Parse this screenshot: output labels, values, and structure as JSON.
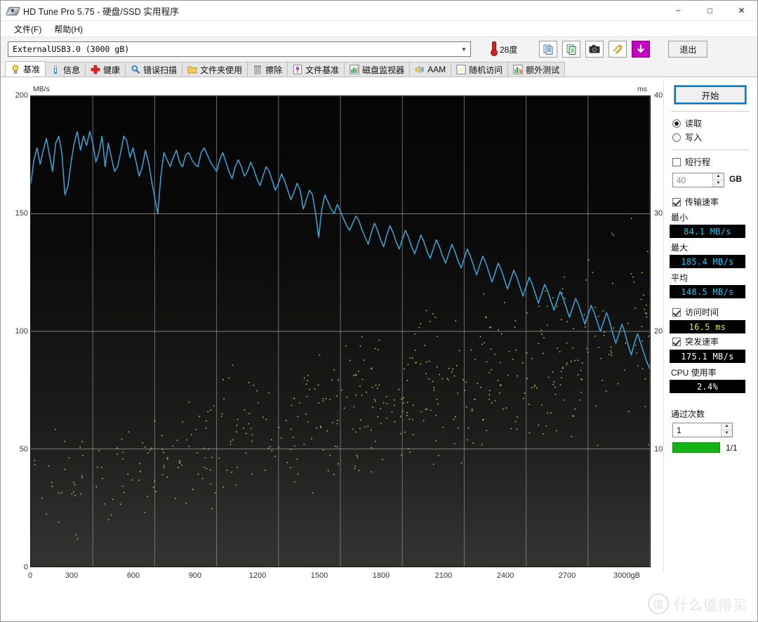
{
  "window": {
    "title": "HD Tune Pro 5.75 - 硬盘/SSD 实用程序",
    "icon": "hard-disk-icon",
    "minimize": "−",
    "maximize": "□",
    "close": "✕"
  },
  "menu": [
    {
      "label": "文件(F)"
    },
    {
      "label": "帮助(H)"
    }
  ],
  "drive": {
    "selected": "ExternalUSB3.0  (3000 gB)",
    "dropdown_arrow": "▼"
  },
  "temperature": {
    "value": "28度",
    "icon": "thermometer-icon"
  },
  "toolbar": {
    "buttons": [
      {
        "name": "copy-icon",
        "label": ""
      },
      {
        "name": "export-excel-icon",
        "label": ""
      },
      {
        "name": "screenshot-camera-icon",
        "label": ""
      },
      {
        "name": "attachment-icon",
        "label": ""
      },
      {
        "name": "download-arrow-icon",
        "label": ""
      }
    ],
    "exit_label": "退出"
  },
  "tabs": [
    {
      "label": "基准",
      "icon": "benchmark-icon",
      "active": true
    },
    {
      "label": "信息",
      "icon": "info-icon",
      "active": false
    },
    {
      "label": "健康",
      "icon": "health-cross-icon",
      "active": false
    },
    {
      "label": "错误扫描",
      "icon": "magnifier-icon",
      "active": false
    },
    {
      "label": "文件夹使用",
      "icon": "folder-icon",
      "active": false
    },
    {
      "label": "擦除",
      "icon": "trash-icon",
      "active": false
    },
    {
      "label": "文件基准",
      "icon": "file-benchmark-icon",
      "active": false
    },
    {
      "label": "磁盘监视器",
      "icon": "disk-monitor-icon",
      "active": false
    },
    {
      "label": "AAM",
      "icon": "speaker-icon",
      "active": false
    },
    {
      "label": "随机访问",
      "icon": "random-access-icon",
      "active": false
    },
    {
      "label": "额外测试",
      "icon": "extra-tests-icon",
      "active": false
    }
  ],
  "panel": {
    "start_label": "开始",
    "mode": {
      "read_label": "读取",
      "write_label": "写入",
      "selected": "读取"
    },
    "short_stroke": {
      "label": "短行程",
      "checked": false,
      "value": "40",
      "unit": "GB"
    },
    "transfer_rate": {
      "label": "传输速率",
      "checked": true
    },
    "minimum": {
      "label": "最小",
      "value": "84.1 MB/s"
    },
    "maximum": {
      "label": "最大",
      "value": "185.4 MB/s"
    },
    "average": {
      "label": "平均",
      "value": "148.5 MB/s"
    },
    "access_time": {
      "label": "访问时间",
      "checked": true,
      "value": "16.5 ms"
    },
    "burst_rate": {
      "label": "突发速率",
      "checked": true,
      "value": "175.1 MB/s"
    },
    "cpu_usage": {
      "label": "CPU 使用率",
      "value": "2.4%"
    },
    "passes": {
      "label": "通过次数",
      "value": "1",
      "progress_text": "1/1",
      "progress_percent": 100
    }
  },
  "colors": {
    "transfer_line": "#3aa6d8",
    "access_dot": "#d8d86a",
    "lcd_cyan": "#19c6f5",
    "lcd_yellow": "#e8e81e",
    "progress_green": "#13b313",
    "accent_purple": "#c300c3"
  },
  "watermark": {
    "mark": "值",
    "text": "什么值得买"
  },
  "chart_data": {
    "type": "line",
    "title": "",
    "xlabel": "gB",
    "ylabel": "MB/s",
    "y2label": "ms",
    "xlim": [
      0,
      3000
    ],
    "ylim": [
      0,
      200
    ],
    "y2lim": [
      0,
      40
    ],
    "xticks": [
      0,
      300,
      600,
      900,
      1200,
      1500,
      1800,
      2100,
      2400,
      2700,
      3000
    ],
    "xtick_labels": [
      "0",
      "300",
      "600",
      "900",
      "1200",
      "1500",
      "1800",
      "2100",
      "2400",
      "2700",
      "3000gB"
    ],
    "yticks": [
      0,
      50,
      100,
      150,
      200
    ],
    "ytick_labels": [
      "0",
      "50",
      "100",
      "150",
      "200"
    ],
    "y2ticks": [
      10,
      20,
      30,
      40
    ],
    "y2tick_labels": [
      "10",
      "20",
      "30",
      "40"
    ],
    "grid": true,
    "legend": "none",
    "series": [
      {
        "name": "传输速率",
        "type": "line",
        "color": "#3aa6d8",
        "axis": "left",
        "units": "MB/s",
        "x": [
          0,
          15,
          30,
          45,
          60,
          75,
          90,
          105,
          120,
          135,
          150,
          165,
          180,
          195,
          210,
          225,
          240,
          255,
          270,
          285,
          300,
          315,
          330,
          345,
          360,
          375,
          390,
          405,
          420,
          435,
          450,
          465,
          480,
          495,
          510,
          525,
          540,
          555,
          570,
          585,
          600,
          615,
          630,
          645,
          660,
          675,
          690,
          705,
          720,
          735,
          750,
          765,
          780,
          795,
          810,
          825,
          840,
          855,
          870,
          885,
          900,
          915,
          930,
          945,
          960,
          975,
          990,
          1005,
          1020,
          1035,
          1050,
          1065,
          1080,
          1095,
          1110,
          1125,
          1140,
          1155,
          1170,
          1185,
          1200,
          1215,
          1230,
          1245,
          1260,
          1275,
          1290,
          1305,
          1320,
          1335,
          1350,
          1365,
          1380,
          1395,
          1410,
          1425,
          1440,
          1455,
          1470,
          1485,
          1500,
          1515,
          1530,
          1545,
          1560,
          1575,
          1590,
          1605,
          1620,
          1635,
          1650,
          1665,
          1680,
          1695,
          1710,
          1725,
          1740,
          1755,
          1770,
          1785,
          1800,
          1815,
          1830,
          1845,
          1860,
          1875,
          1890,
          1905,
          1920,
          1935,
          1950,
          1965,
          1980,
          1995,
          2010,
          2025,
          2040,
          2055,
          2070,
          2085,
          2100,
          2115,
          2130,
          2145,
          2160,
          2175,
          2190,
          2205,
          2220,
          2235,
          2250,
          2265,
          2280,
          2295,
          2310,
          2325,
          2340,
          2355,
          2370,
          2385,
          2400,
          2415,
          2430,
          2445,
          2460,
          2475,
          2490,
          2505,
          2520,
          2535,
          2550,
          2565,
          2580,
          2595,
          2610,
          2625,
          2640,
          2655,
          2670,
          2685,
          2700,
          2715,
          2730,
          2745,
          2760,
          2775,
          2790,
          2805,
          2820,
          2835,
          2850,
          2865,
          2880,
          2895,
          2910,
          2925,
          2940,
          2955,
          2970,
          2985,
          3000
        ],
        "y": [
          163,
          173,
          178,
          171,
          177,
          182,
          175,
          168,
          180,
          183,
          176,
          158,
          162,
          172,
          180,
          185,
          177,
          183,
          179,
          185,
          180,
          172,
          176,
          183,
          170,
          180,
          174,
          168,
          170,
          176,
          183,
          181,
          174,
          178,
          172,
          166,
          170,
          177,
          172,
          164,
          157,
          150,
          166,
          176,
          173,
          170,
          174,
          177,
          172,
          170,
          175,
          176,
          173,
          171,
          170,
          176,
          178,
          175,
          172,
          170,
          168,
          173,
          176,
          172,
          168,
          165,
          170,
          173,
          170,
          166,
          168,
          172,
          169,
          165,
          162,
          166,
          170,
          168,
          164,
          160,
          163,
          167,
          164,
          160,
          156,
          159,
          163,
          160,
          152,
          156,
          160,
          158,
          150,
          140,
          152,
          158,
          155,
          152,
          150,
          154,
          151,
          148,
          145,
          143,
          146,
          149,
          147,
          143,
          140,
          137,
          142,
          146,
          143,
          139,
          136,
          141,
          145,
          142,
          138,
          135,
          139,
          143,
          140,
          136,
          133,
          137,
          141,
          138,
          134,
          131,
          135,
          139,
          136,
          132,
          129,
          133,
          137,
          134,
          130,
          127,
          131,
          135,
          132,
          128,
          124,
          128,
          132,
          129,
          125,
          121,
          125,
          129,
          126,
          122,
          118,
          122,
          126,
          123,
          119,
          115,
          119,
          123,
          120,
          116,
          112,
          116,
          120,
          117,
          113,
          109,
          113,
          117,
          114,
          110,
          106,
          110,
          114,
          111,
          107,
          103,
          107,
          111,
          108,
          104,
          100,
          104,
          108,
          104,
          99,
          95,
          99,
          103,
          99,
          94,
          90,
          95,
          99,
          95,
          91,
          87,
          84,
          88,
          90
        ]
      },
      {
        "name": "访问时间",
        "type": "scatter",
        "color": "#d8d86a",
        "axis": "right",
        "units": "ms",
        "description": "随机访问时间散点，整体由左下 5ms 向右上 25ms 扩散"
      }
    ]
  }
}
